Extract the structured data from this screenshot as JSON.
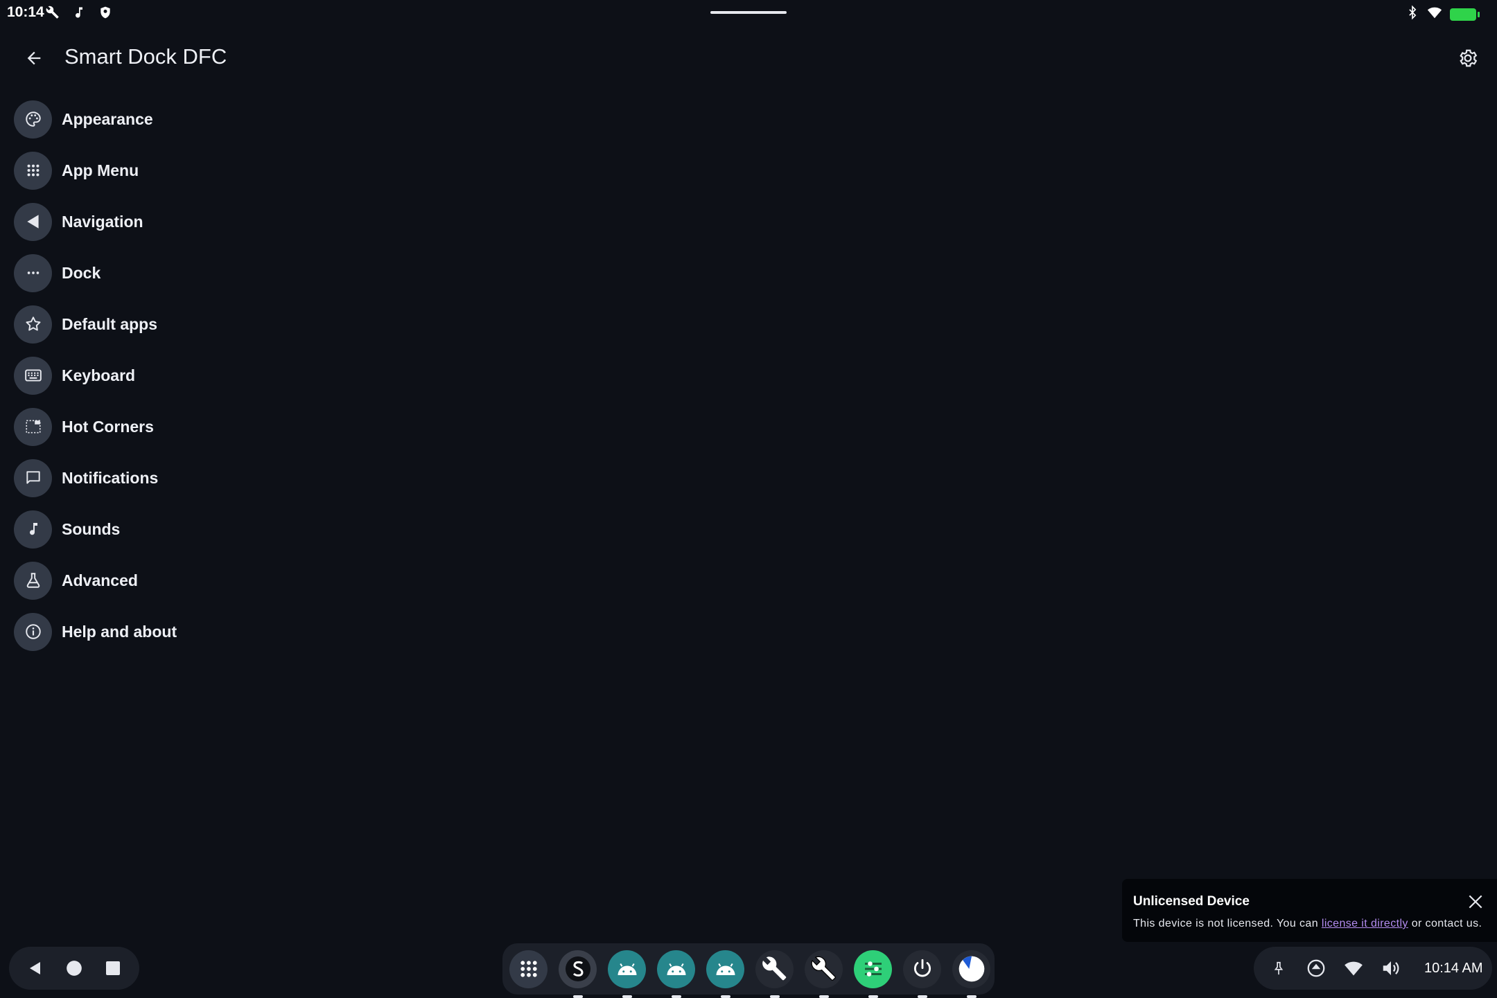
{
  "status_bar": {
    "time": "10:14"
  },
  "app_bar": {
    "title": "Smart Dock DFC"
  },
  "menu": {
    "items": [
      {
        "label": "Appearance",
        "icon": "palette-icon"
      },
      {
        "label": "App Menu",
        "icon": "apps-grid-icon"
      },
      {
        "label": "Navigation",
        "icon": "navigation-icon"
      },
      {
        "label": "Dock",
        "icon": "more-horizontal-icon"
      },
      {
        "label": "Default apps",
        "icon": "star-icon"
      },
      {
        "label": "Keyboard",
        "icon": "keyboard-icon"
      },
      {
        "label": "Hot Corners",
        "icon": "hot-corners-icon"
      },
      {
        "label": "Notifications",
        "icon": "message-icon"
      },
      {
        "label": "Sounds",
        "icon": "music-note-icon"
      },
      {
        "label": "Advanced",
        "icon": "flask-icon"
      },
      {
        "label": "Help and about",
        "icon": "info-icon"
      }
    ]
  },
  "toast": {
    "title": "Unlicensed Device",
    "message_prefix": "This device is not licensed. You can ",
    "link_text": "license it directly",
    "message_suffix": " or contact us."
  },
  "tray": {
    "clock": "10:14 AM"
  },
  "colors": {
    "background": "#0d1017",
    "icon_circle": "#333a47",
    "panel": "#1c2029",
    "teal": "#26868c",
    "green": "#2fd34a",
    "link": "#b48cf0"
  }
}
